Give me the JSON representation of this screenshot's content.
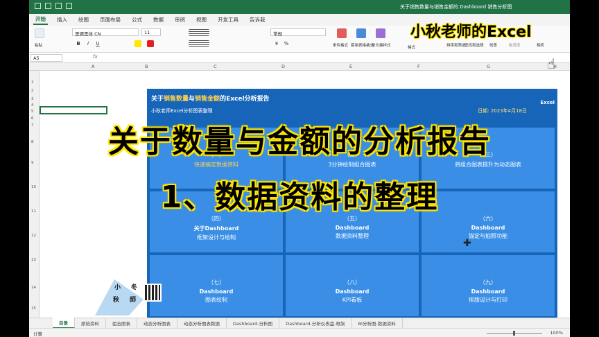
{
  "window": {
    "title": "关于销售数量与销售金额的 Dashboard 销售分析图"
  },
  "ribbon_tabs": [
    "开始",
    "插入",
    "绘图",
    "页面布局",
    "公式",
    "数据",
    "审阅",
    "视图",
    "开发工具",
    "告诉我"
  ],
  "ribbon": {
    "paste": "粘贴",
    "font_name": "思源黑体 CN",
    "font_size": "11",
    "number_format": "常规",
    "cond_format": "条件格式",
    "table_format": "套用表格格式",
    "cell_style": "单元格样式",
    "format": "格式",
    "sort": "排序和筛选",
    "find": "查找和选择",
    "create": "创意",
    "sensitivity": "敏感度",
    "camera": "相机"
  },
  "namebox": "A5",
  "columns": [
    "A",
    "B",
    "C",
    "D",
    "E",
    "F",
    "G",
    "H"
  ],
  "rows": [
    "1",
    "2",
    "3",
    "4",
    "5",
    "6",
    "7",
    "8",
    "9",
    "10",
    "11",
    "12",
    "13",
    "14",
    "15"
  ],
  "panel": {
    "title_pre": "关于",
    "title_h1": "销售数量",
    "title_mid": "与",
    "title_h2": "销售金额",
    "title_post": "的Excel分析报告",
    "subtitle": "小秋老师Excel分析图表整理",
    "date": "日期: 2023年4月18日",
    "brand": "Excel",
    "cells": [
      {
        "num": "（一）",
        "l1": "",
        "l2": "快速搞定数据资料",
        "yellow": true
      },
      {
        "num": "（二）",
        "l1": "",
        "l2": "3分钟绘制组合图表",
        "yellow": false
      },
      {
        "num": "（三）",
        "l1": "",
        "l2": "将组合图表提升为动态图表",
        "yellow": false
      },
      {
        "num": "（四）",
        "l1": "关于Dashboard",
        "l2": "框架设计与绘制",
        "yellow": false
      },
      {
        "num": "（五）",
        "l1": "Dashboard",
        "l2": "数据资料整理",
        "yellow": false
      },
      {
        "num": "（六）",
        "l1": "Dashboard",
        "l2": "锚定与拍照功能",
        "yellow": false
      },
      {
        "num": "（七）",
        "l1": "Dashboard",
        "l2": "图表绘制",
        "yellow": false
      },
      {
        "num": "（八）",
        "l1": "Dashboard",
        "l2": "KPI看板",
        "yellow": false
      },
      {
        "num": "（九）",
        "l1": "Dashboard",
        "l2": "排版设计与打印",
        "yellow": false
      }
    ]
  },
  "overlay": {
    "main": "关于数量与金额的分析报告",
    "sub": "1、数据资料的整理",
    "brand": "小秋老师的Excel"
  },
  "logo": {
    "chars": [
      "小",
      "冬",
      "秋",
      "師"
    ]
  },
  "sheets": [
    "目录",
    "原始资料",
    "组合图表",
    "动态分析图表",
    "动态分析图表数据",
    "Dashboard-分析图",
    "Dashboard-分析仪表盘-框架",
    "BI分析图-数据资料"
  ],
  "status": {
    "ready": "计算",
    "zoom": "100%"
  },
  "colors": {
    "excel_green": "#217346",
    "panel_blue": "#1765b8",
    "cell_blue": "#3a8ee6",
    "highlight_yellow": "#ffe500"
  }
}
